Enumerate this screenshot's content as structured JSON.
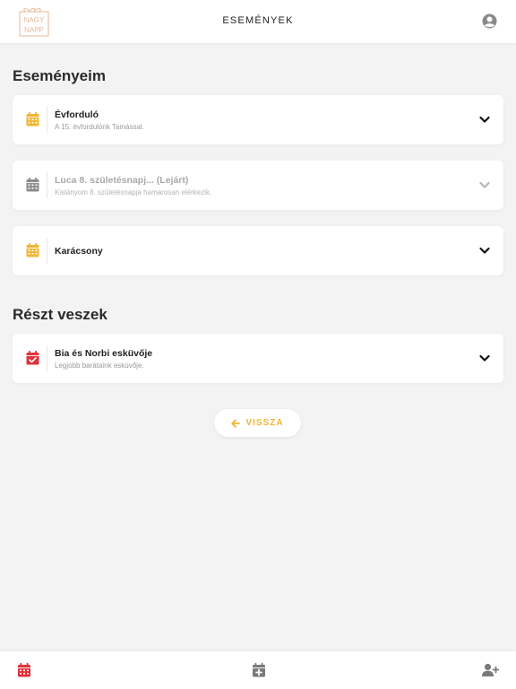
{
  "header": {
    "title": "ESEMÉNYEK",
    "logo_text_line1": "NAGY",
    "logo_text_line2": "NAPP"
  },
  "my_events": {
    "section_title": "Eseményeim",
    "items": [
      {
        "title": "Évforduló",
        "subtitle": "A 15. évfordulónk Tamással.",
        "icon": "calendar-icon",
        "status": "active"
      },
      {
        "title": "Luca 8. születésnapj... (Lejárt)",
        "subtitle": "Kislányom 8. születésnapja hamarosan elérkezik.",
        "icon": "calendar-icon",
        "status": "expired"
      },
      {
        "title": "Karácsony",
        "subtitle": "",
        "icon": "calendar-icon",
        "status": "active"
      }
    ]
  },
  "attending": {
    "section_title": "Részt veszek",
    "items": [
      {
        "title": "Bia és Norbi esküvője",
        "subtitle": "Legjobb barátaink esküvője.",
        "icon": "calendar-check-icon",
        "status": "attending"
      }
    ]
  },
  "back_button": {
    "label": "VISSZA",
    "icon": "arrow-left-icon"
  },
  "bottom_nav": {
    "items": [
      {
        "icon": "calendar-icon",
        "active": true
      },
      {
        "icon": "calendar-add-icon",
        "active": false
      },
      {
        "icon": "user-add-icon",
        "active": false
      }
    ]
  },
  "colors": {
    "accent": "#f0b532",
    "danger": "#e0323c",
    "muted_icon": "#9a9a9a",
    "dark_icon": "#7a7a7a",
    "background": "#f4f3f4"
  }
}
